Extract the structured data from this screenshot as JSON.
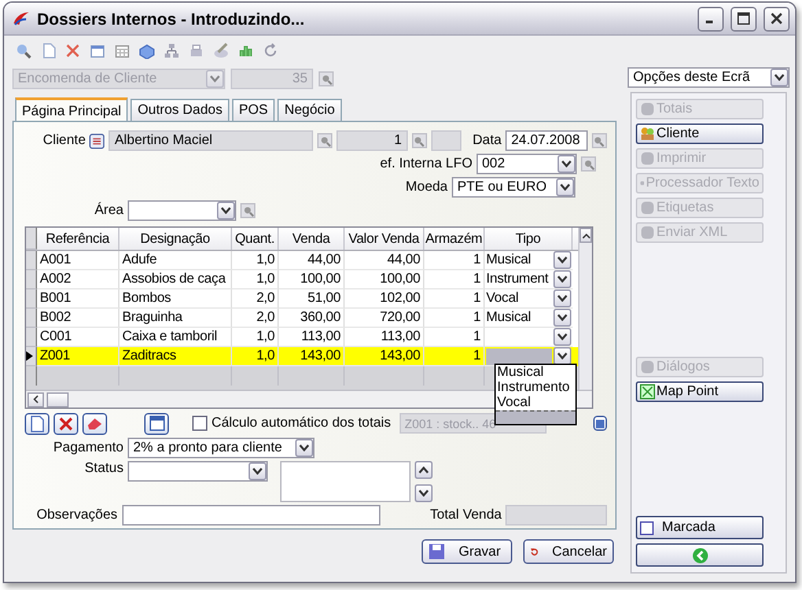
{
  "window": {
    "title": "Dossiers Internos - Introduzindo..."
  },
  "document": {
    "type": "Encomenda de Cliente",
    "number": "35",
    "disabled": true
  },
  "tabs": [
    {
      "label": "Página Principal",
      "selected": true
    },
    {
      "label": "Outros Dados",
      "selected": false
    },
    {
      "label": "POS",
      "selected": false
    },
    {
      "label": "Negócio",
      "selected": false
    }
  ],
  "header": {
    "cliente": {
      "label": "Cliente",
      "name": "Albertino Maciel",
      "number": "1"
    },
    "data": {
      "label": "Data",
      "value": "24.07.2008"
    },
    "ref_interna": {
      "label": "ef. Interna LFO",
      "value": "002"
    },
    "moeda": {
      "label": "Moeda",
      "value": "PTE ou EURO"
    },
    "area": {
      "label": "Área"
    }
  },
  "grid": {
    "columns": [
      "Referência",
      "Designação",
      "Quant.",
      "Venda",
      "Valor Venda",
      "Armazém",
      "Tipo"
    ],
    "rows": [
      {
        "cells": [
          "A001",
          "Adufe",
          "1,0",
          "44,00",
          "44,00",
          "1"
        ],
        "tipo": "Musical",
        "selected": false
      },
      {
        "cells": [
          "A002",
          "Assobios de caça",
          "1,0",
          "100,00",
          "100,00",
          "1"
        ],
        "tipo": "Instrument",
        "selected": false
      },
      {
        "cells": [
          "B001",
          "Bombos",
          "2,0",
          "51,00",
          "102,00",
          "1"
        ],
        "tipo": "Vocal",
        "selected": false
      },
      {
        "cells": [
          "B002",
          "Braguinha",
          "2,0",
          "360,00",
          "720,00",
          "1"
        ],
        "tipo": "Musical",
        "selected": false
      },
      {
        "cells": [
          "C001",
          "Caixa e tamboril",
          "1,0",
          "113,00",
          "113,00",
          "1"
        ],
        "selected": false
      },
      {
        "cells": [
          "Z001",
          "Zaditracs",
          "1,0",
          "143,00",
          "143,00",
          "1"
        ],
        "selected": true
      }
    ],
    "dropdown": {
      "options": [
        "Musical",
        "Instrumento",
        "Vocal"
      ]
    }
  },
  "auto_calc": {
    "label": "Cálculo automático dos totais",
    "checked": false
  },
  "stock_info": "Z001 : stock.. 46",
  "footer_fields": {
    "pagamento": {
      "label": "Pagamento",
      "value": "2% a pronto para cliente"
    },
    "status": {
      "label": "Status"
    },
    "observacoes": {
      "label": "Observações"
    },
    "total_venda": {
      "label": "Total Venda"
    }
  },
  "buttons": [
    {
      "label": "Gravar",
      "kind": "save"
    },
    {
      "label": "Cancelar",
      "kind": "cancel"
    }
  ],
  "side_panel": {
    "select": "Opções deste Ecrã",
    "actions": [
      {
        "label": "Totais",
        "disabled": true
      },
      {
        "label": "Cliente",
        "disabled": false
      },
      {
        "label": "Imprimir",
        "disabled": true
      },
      {
        "label": "Processador Texto",
        "disabled": true
      },
      {
        "label": "Etiquetas",
        "disabled": true
      },
      {
        "label": "Enviar XML",
        "disabled": true
      }
    ],
    "extra_actions": [
      {
        "label": "Diálogos",
        "disabled": true
      },
      {
        "label": "Map Point",
        "disabled": false
      }
    ],
    "footer_actions": [
      {
        "kind": "toggle",
        "label": "Marcada",
        "checked": false
      },
      {
        "kind": "icon"
      }
    ]
  }
}
